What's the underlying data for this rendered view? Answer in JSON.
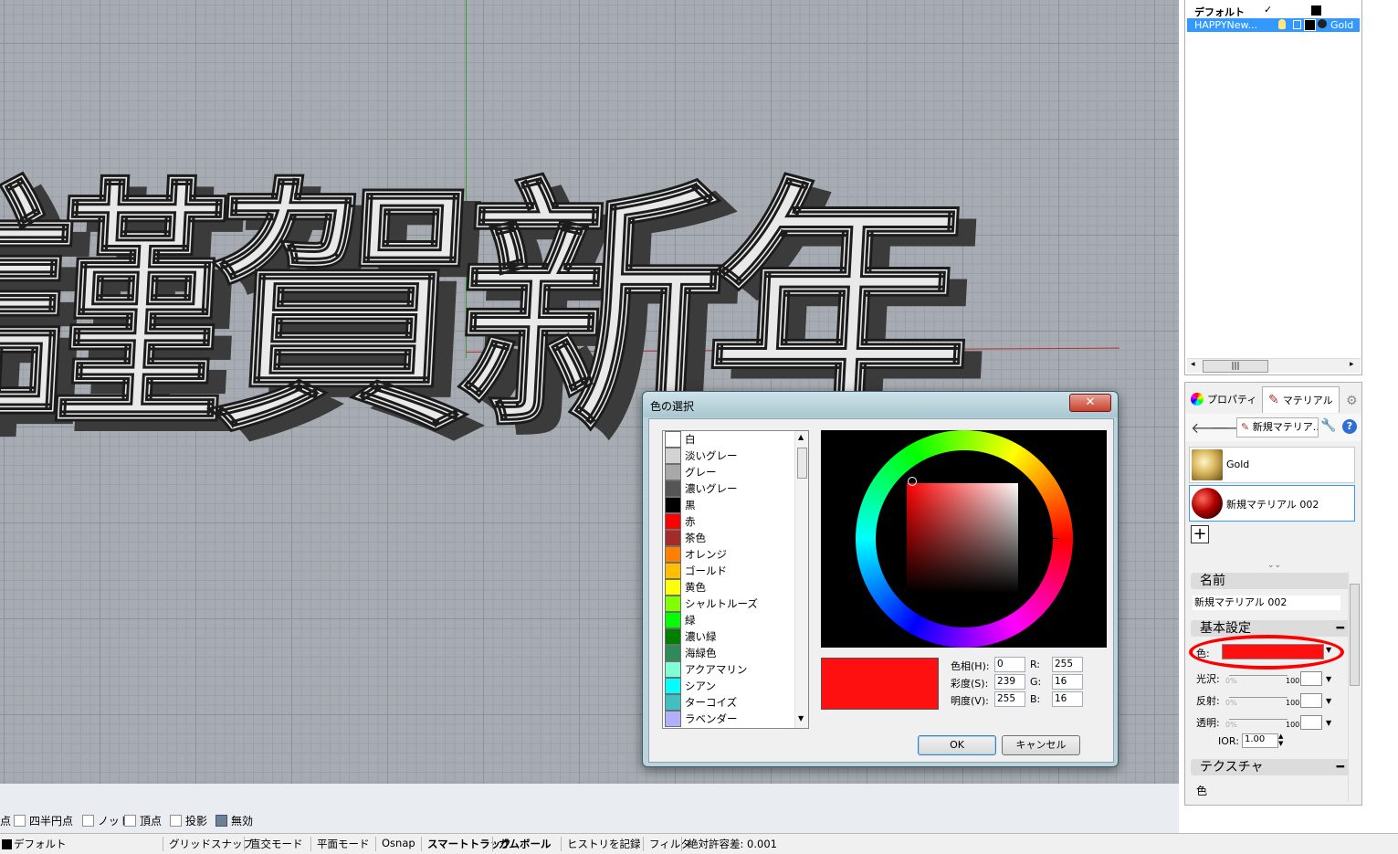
{
  "viewport": {
    "big_text": "謹賀新年"
  },
  "osnap_bar": {
    "items": [
      {
        "label": "点",
        "checked": false,
        "show_box": false
      },
      {
        "label": "四半円点",
        "checked": false,
        "show_box": true
      },
      {
        "label": "ノット",
        "checked": false,
        "show_box": true
      },
      {
        "label": "頂点",
        "checked": false,
        "show_box": true
      },
      {
        "label": "投影",
        "checked": false,
        "show_box": true
      },
      {
        "label": "無効",
        "checked": true,
        "show_box": true
      }
    ]
  },
  "status_bar": {
    "layer": "デフォルト",
    "grid_snap": "グリッドスナップ",
    "ortho": "直交モード",
    "planar": "平面モード",
    "osnap": "Osnap",
    "smart_track": "スマートトラック",
    "gumball": "ガムボール",
    "history": "ヒストリを記録",
    "filter": "フィルタ",
    "tolerance": "絶対許容差: 0.001"
  },
  "layers_panel": {
    "rows": [
      {
        "name": "デフォルト",
        "check": "✓",
        "material": ""
      },
      {
        "name": "HAPPYNew...",
        "check": "",
        "material": "Gold"
      }
    ],
    "scroll_label": "|||"
  },
  "material_panel": {
    "tabs": {
      "properties": "プロパティ",
      "materials": "マテリアル"
    },
    "new_material_label": "新規マテリア...",
    "help_label": "?",
    "materials": [
      {
        "name": "Gold"
      },
      {
        "name": "新規マテリアル 002"
      }
    ],
    "add_label": "+",
    "name_section": "名前",
    "name_value": "新規マテリアル 002",
    "basic_section": "基本設定",
    "color_label": "色:",
    "color_value": "#ff1010",
    "gloss_label": "光沢:",
    "reflect_label": "反射:",
    "transparency_label": "透明:",
    "slider_min": "0%",
    "slider_max": "100",
    "ior_label": "IOR:",
    "ior_value": "1.00",
    "texture_section": "テクスチャ",
    "texture_color_label": "色"
  },
  "color_dialog": {
    "title": "色の選択",
    "close_label": "✕",
    "colors": [
      {
        "name": "白",
        "hex": "#ffffff"
      },
      {
        "name": "淡いグレー",
        "hex": "#d3d3d3"
      },
      {
        "name": "グレー",
        "hex": "#a8a8a8"
      },
      {
        "name": "濃いグレー",
        "hex": "#555555"
      },
      {
        "name": "黒",
        "hex": "#000000"
      },
      {
        "name": "赤",
        "hex": "#ff0000"
      },
      {
        "name": "茶色",
        "hex": "#a52a2a"
      },
      {
        "name": "オレンジ",
        "hex": "#ff8000"
      },
      {
        "name": "ゴールド",
        "hex": "#ffbf00"
      },
      {
        "name": "黄色",
        "hex": "#ffff00"
      },
      {
        "name": "シャルトルーズ",
        "hex": "#80ff00"
      },
      {
        "name": "緑",
        "hex": "#00ff00"
      },
      {
        "name": "濃い緑",
        "hex": "#008000"
      },
      {
        "name": "海緑色",
        "hex": "#2e8b57"
      },
      {
        "name": "アクアマリン",
        "hex": "#7fffd4"
      },
      {
        "name": "シアン",
        "hex": "#00ffff"
      },
      {
        "name": "ターコイズ",
        "hex": "#40c0c0"
      },
      {
        "name": "ラベンダー",
        "hex": "#b0b0ff"
      }
    ],
    "selected_hex": "#ff1010",
    "hue_label": "色相(H):",
    "hue_value": "0",
    "sat_label": "彩度(S):",
    "sat_value": "239",
    "val_label": "明度(V):",
    "val_value": "255",
    "r_label": "R:",
    "r_value": "255",
    "g_label": "G:",
    "g_value": "16",
    "b_label": "B:",
    "b_value": "16",
    "ok_label": "OK",
    "cancel_label": "キャンセル"
  }
}
